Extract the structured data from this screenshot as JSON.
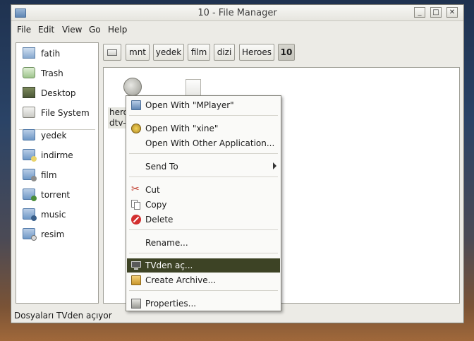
{
  "window": {
    "title": "10 - File Manager",
    "minimize": "_",
    "maximize": "□",
    "close": "✕"
  },
  "menubar": [
    {
      "label": "File",
      "mnemonic": "F"
    },
    {
      "label": "Edit",
      "mnemonic": "E"
    },
    {
      "label": "View",
      "mnemonic": "V"
    },
    {
      "label": "Go",
      "mnemonic": "G"
    },
    {
      "label": "Help",
      "mnemonic": "H"
    }
  ],
  "sidebar": {
    "places": [
      {
        "label": "fatih",
        "icon": "home-folder-icon"
      },
      {
        "label": "Trash",
        "icon": "trash-icon"
      },
      {
        "label": "Desktop",
        "icon": "desktop-icon"
      },
      {
        "label": "File System",
        "icon": "drive-icon"
      }
    ],
    "bookmarks": [
      {
        "label": "yedek",
        "icon": "folder-icon"
      },
      {
        "label": "indirme",
        "icon": "folder-icon"
      },
      {
        "label": "film",
        "icon": "folder-icon"
      },
      {
        "label": "torrent",
        "icon": "folder-icon"
      },
      {
        "label": "music",
        "icon": "folder-icon"
      },
      {
        "label": "resim",
        "icon": "folder-icon"
      }
    ]
  },
  "pathbar": {
    "crumbs": [
      "mnt",
      "yedek",
      "film",
      "dizi",
      "Heroes",
      "10"
    ]
  },
  "files": [
    {
      "name_line1": "hero",
      "name_line2": "dtv-",
      "icon": "video-file-icon"
    },
    {
      "name_line1": "",
      "name_line2": "",
      "icon": "document-file-icon"
    }
  ],
  "context_menu": {
    "items": [
      {
        "label": "Open With \"MPlayer\"",
        "icon": "mplayer-icon"
      },
      {
        "label": "Open With \"xine\"",
        "icon": "xine-icon"
      },
      {
        "label": "Open With Other Application...",
        "icon": ""
      },
      {
        "label": "Send To",
        "icon": "",
        "submenu": true
      },
      {
        "label": "Cut",
        "icon": "scissors-icon"
      },
      {
        "label": "Copy",
        "icon": "copy-icon"
      },
      {
        "label": "Delete",
        "icon": "delete-icon"
      },
      {
        "label": "Rename...",
        "icon": ""
      },
      {
        "label": "TVden aç...",
        "icon": "monitor-icon",
        "selected": true
      },
      {
        "label": "Create Archive...",
        "icon": "archive-icon"
      },
      {
        "label": "Properties...",
        "icon": "properties-icon"
      }
    ]
  },
  "statusbar": {
    "text": "Dosyaları TVden açıyor"
  },
  "colors": {
    "selection": "#3d4325",
    "window_bg": "#ecebe6"
  }
}
